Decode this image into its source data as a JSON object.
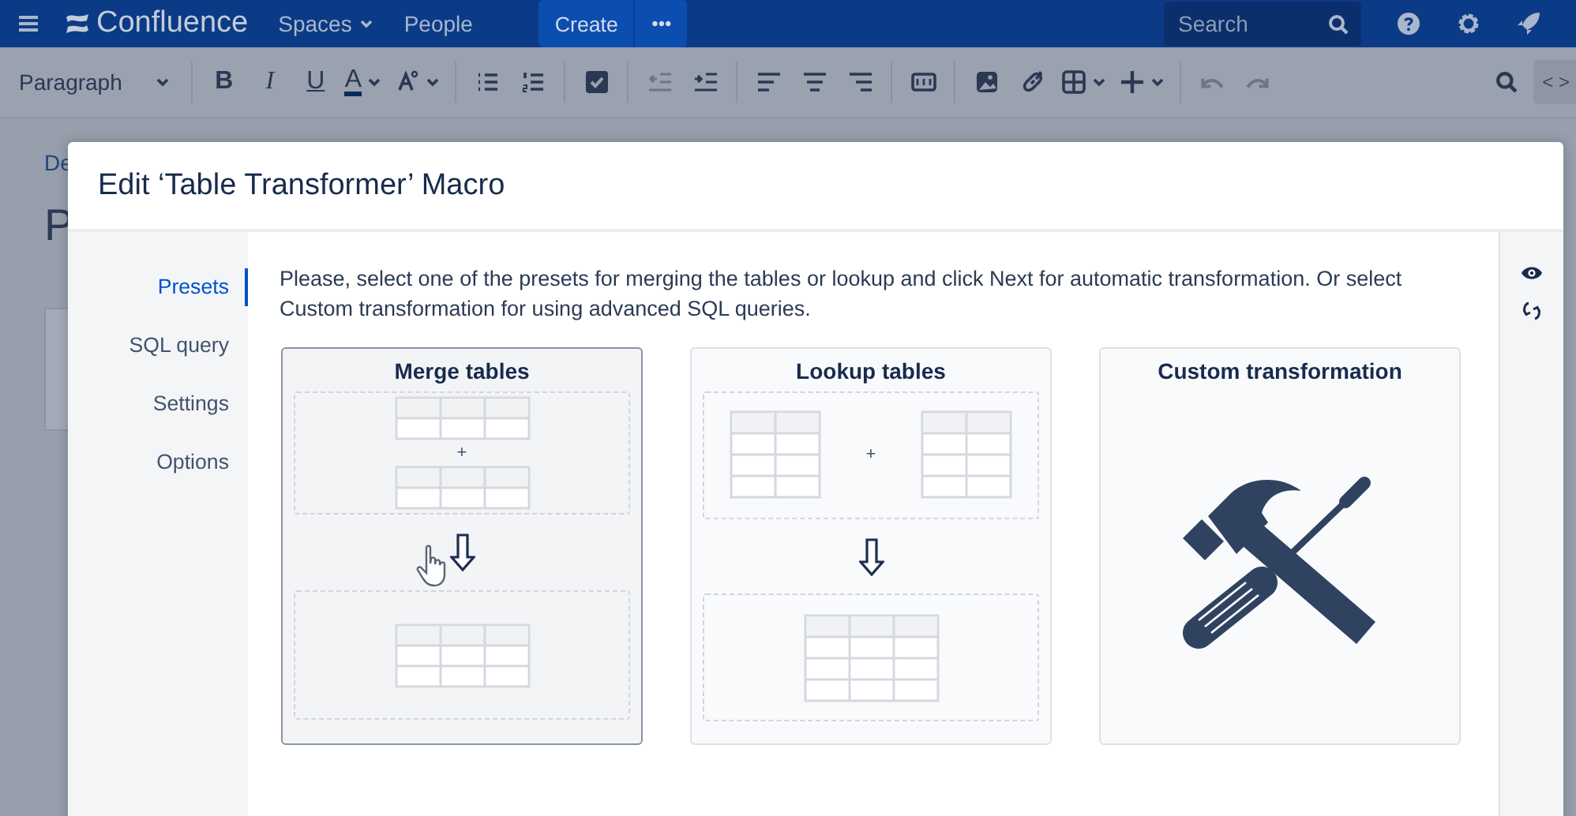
{
  "top_nav": {
    "product": "Confluence",
    "links": [
      {
        "label": "Spaces",
        "dropdown": true
      },
      {
        "label": "People",
        "dropdown": false
      }
    ],
    "create_button": "Create",
    "more_button": "•••",
    "search": {
      "placeholder": "Search"
    }
  },
  "toolbar": {
    "groups": [
      [
        {
          "kind": "style-select",
          "label": "Paragraph",
          "dropdown": true,
          "disabled": false
        }
      ],
      [
        {
          "kind": "bold",
          "label": "B",
          "dropdown": false,
          "disabled": false
        },
        {
          "kind": "italic",
          "label": "I",
          "dropdown": false,
          "disabled": false
        },
        {
          "kind": "underline",
          "label": "U",
          "dropdown": false,
          "disabled": false
        },
        {
          "kind": "text-color",
          "label": "A",
          "dropdown": true,
          "disabled": false
        },
        {
          "kind": "text-style",
          "dropdown": true,
          "disabled": false
        }
      ],
      [
        {
          "kind": "bullet-list",
          "dropdown": false,
          "disabled": false
        },
        {
          "kind": "numbered-list",
          "dropdown": false,
          "disabled": false
        }
      ],
      [
        {
          "kind": "task-list",
          "dropdown": false,
          "disabled": false
        }
      ],
      [
        {
          "kind": "outdent",
          "dropdown": false,
          "disabled": true
        },
        {
          "kind": "indent",
          "dropdown": false,
          "disabled": false
        }
      ],
      [
        {
          "kind": "align-left",
          "dropdown": false,
          "disabled": false
        },
        {
          "kind": "align-center",
          "dropdown": false,
          "disabled": false
        },
        {
          "kind": "align-right",
          "dropdown": false,
          "disabled": false
        }
      ],
      [
        {
          "kind": "page-layout",
          "dropdown": false,
          "disabled": false
        }
      ],
      [
        {
          "kind": "image",
          "dropdown": false,
          "disabled": false
        },
        {
          "kind": "link",
          "dropdown": false,
          "disabled": false
        },
        {
          "kind": "table",
          "dropdown": true,
          "disabled": false
        },
        {
          "kind": "insert",
          "dropdown": true,
          "disabled": false
        }
      ],
      [
        {
          "kind": "undo",
          "dropdown": false,
          "disabled": true
        },
        {
          "kind": "redo",
          "dropdown": false,
          "disabled": true
        }
      ]
    ],
    "code_button": "< >"
  },
  "page": {
    "breadcrumb": "De",
    "title": "P"
  },
  "dialog": {
    "title": "Edit ‘Table Transformer’ Macro",
    "nav": [
      {
        "label": "Presets",
        "selected": true
      },
      {
        "label": "SQL query",
        "selected": false
      },
      {
        "label": "Settings",
        "selected": false
      },
      {
        "label": "Options",
        "selected": false
      }
    ],
    "intro": "Please, select one of the presets for merging the tables or lookup and click Next for automatic transformation. Or select Custom transformation for using advanced SQL queries.",
    "presets": [
      {
        "kind": "merge",
        "title": "Merge tables",
        "operator": "+",
        "hovered": true
      },
      {
        "kind": "lookup",
        "title": "Lookup tables",
        "operator": "+",
        "hovered": false
      },
      {
        "kind": "custom",
        "title": "Custom transformation",
        "hovered": false
      }
    ]
  }
}
